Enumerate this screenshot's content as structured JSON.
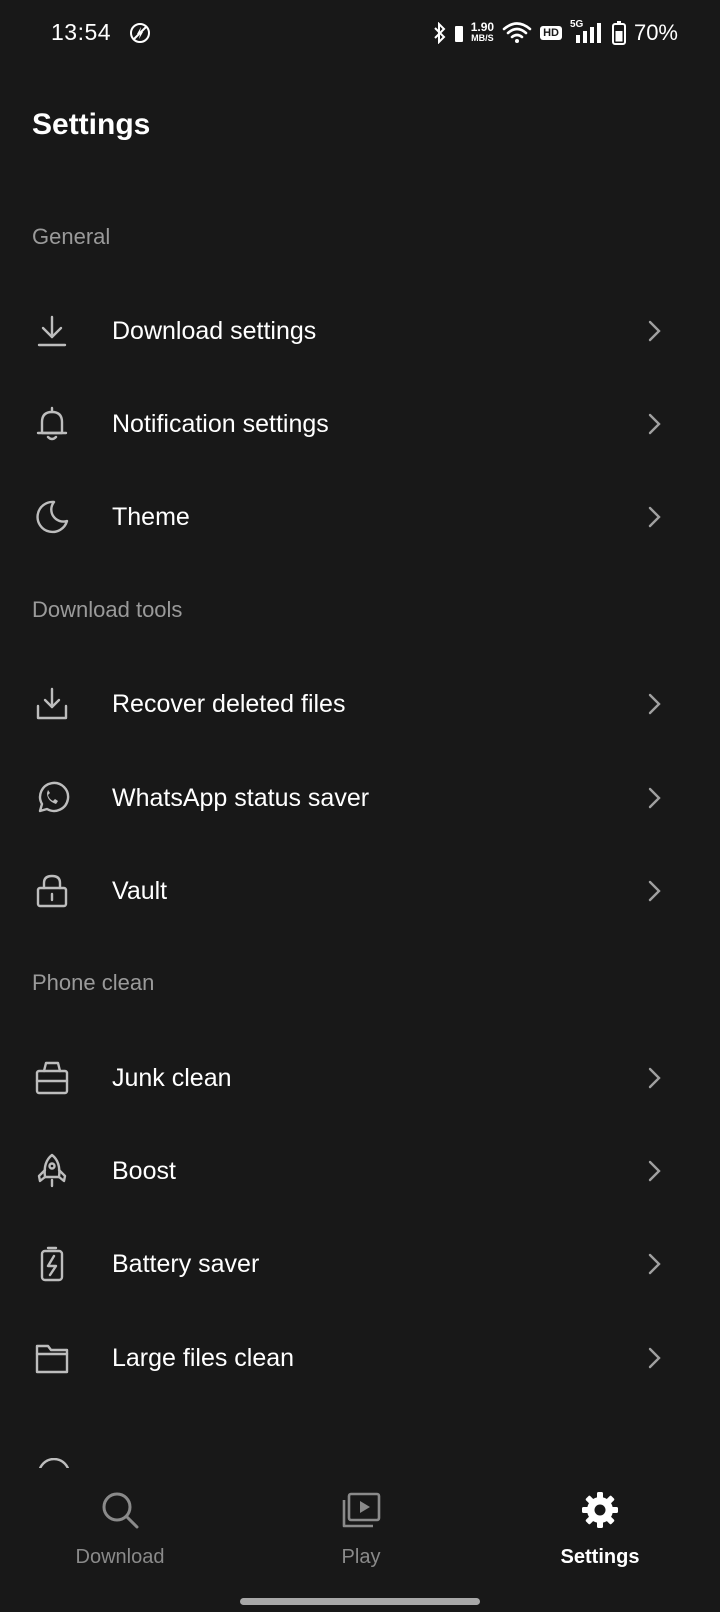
{
  "status_bar": {
    "time": "13:54",
    "speed_value": "1.90",
    "speed_unit": "MB/S",
    "hd": "HD",
    "network": "5G",
    "battery": "70%"
  },
  "page": {
    "title": "Settings"
  },
  "sections": [
    {
      "header": "General",
      "items": [
        {
          "label": "Download settings",
          "icon": "download-icon"
        },
        {
          "label": "Notification settings",
          "icon": "bell-icon"
        },
        {
          "label": "Theme",
          "icon": "moon-icon"
        }
      ]
    },
    {
      "header": "Download tools",
      "items": [
        {
          "label": "Recover deleted files",
          "icon": "tray-download-icon"
        },
        {
          "label": "WhatsApp status saver",
          "icon": "whatsapp-icon"
        },
        {
          "label": "Vault",
          "icon": "lock-icon"
        }
      ]
    },
    {
      "header": "Phone clean",
      "items": [
        {
          "label": "Junk clean",
          "icon": "basket-icon"
        },
        {
          "label": "Boost",
          "icon": "rocket-icon"
        },
        {
          "label": "Battery saver",
          "icon": "battery-icon"
        },
        {
          "label": "Large files clean",
          "icon": "folder-icon"
        }
      ]
    }
  ],
  "bottom_nav": {
    "items": [
      {
        "label": "Download",
        "icon": "search-icon",
        "active": false
      },
      {
        "label": "Play",
        "icon": "play-icon",
        "active": false
      },
      {
        "label": "Settings",
        "icon": "gear-icon",
        "active": true
      }
    ]
  },
  "colors": {
    "background": "#181818",
    "text": "#ffffff",
    "section_header": "#9a9a9a",
    "inactive_nav": "#8a8a8a"
  }
}
